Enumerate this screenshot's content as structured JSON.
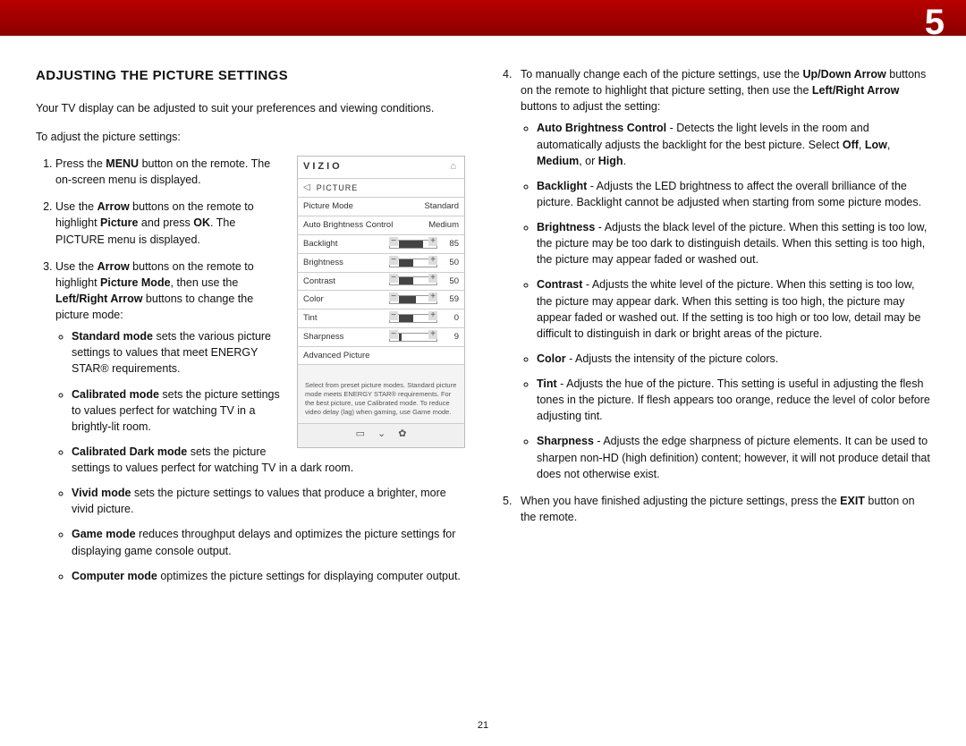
{
  "chapter": "5",
  "pageNumber": "21",
  "heading": "ADJUSTING THE PICTURE SETTINGS",
  "intro": "Your TV display can be adjusted to suit your preferences and viewing conditions.",
  "lead": "To adjust the picture settings:",
  "step1_a": "Press the ",
  "step1_b": "MENU",
  "step1_c": " button on the remote. The on-screen menu is displayed.",
  "step2_a": "Use the ",
  "step2_b": "Arrow",
  "step2_c": " buttons on the remote to highlight ",
  "step2_d": "Picture",
  "step2_e": " and press ",
  "step2_f": "OK",
  "step2_g": ". The PICTURE menu is displayed.",
  "step3_a": "Use the ",
  "step3_b": "Arrow",
  "step3_c": " buttons on the remote to highlight ",
  "step3_d": "Picture Mode",
  "step3_e": ", then use the ",
  "step3_f": "Left/Right Arrow",
  "step3_g": " buttons to change the picture mode:",
  "mode_std_a": "Standard mode",
  "mode_std_b": " sets the various picture settings to values that meet ENERGY STAR® requirements.",
  "mode_cal_a": "Calibrated mode",
  "mode_cal_b": " sets the picture settings to values perfect for watching TV in a brightly-lit room.",
  "mode_caldark_a": "Calibrated Dark mode",
  "mode_caldark_b": " sets the picture settings to values perfect for watching TV in a dark room.",
  "mode_vivid_a": "Vivid mode",
  "mode_vivid_b": " sets the picture settings to values that produce a brighter, more vivid picture.",
  "mode_game_a": "Game mode",
  "mode_game_b": " reduces throughput delays and optimizes the picture settings for displaying game console output.",
  "mode_comp_a": "Computer mode",
  "mode_comp_b": " optimizes the picture settings for displaying computer output.",
  "step4_a": "To manually change each of the picture settings, use the ",
  "step4_b": "Up/Down Arrow",
  "step4_c": " buttons on the remote to highlight that picture setting, then use the ",
  "step4_d": "Left/Right Arrow",
  "step4_e": " buttons to adjust the setting:",
  "set_abc_a": "Auto Brightness Control",
  "set_abc_b": " - Detects the light levels in the room and automatically adjusts the backlight for the best picture. Select ",
  "set_abc_c": "Off",
  "set_abc_d": ", ",
  "set_abc_e": "Low",
  "set_abc_f": ", ",
  "set_abc_g": "Medium",
  "set_abc_h": ", or ",
  "set_abc_i": "High",
  "set_abc_j": ".",
  "set_back_a": "Backlight",
  "set_back_b": " - Adjusts the LED brightness to affect the overall brilliance of the picture. Backlight cannot be adjusted when starting from some picture modes.",
  "set_bri_a": "Brightness",
  "set_bri_b": " - Adjusts the black level of the picture. When this setting is too low, the picture may be too dark to distinguish details. When this setting is too high, the picture may appear faded or washed out.",
  "set_con_a": "Contrast",
  "set_con_b": " - Adjusts the white level of the picture. When this setting is too low, the picture may appear dark. When this setting is too high, the picture may appear faded or washed out. If the setting is too high or too low, detail may be difficult to distinguish in dark or bright areas of the picture.",
  "set_col_a": "Color",
  "set_col_b": " - Adjusts the intensity of the picture colors.",
  "set_tint_a": "Tint",
  "set_tint_b": " - Adjusts the hue of the picture. This setting is useful in adjusting the flesh tones in the picture. If flesh appears too orange, reduce the level of color before adjusting tint.",
  "set_sharp_a": "Sharpness",
  "set_sharp_b": " - Adjusts the edge sharpness of picture elements. It can be used to sharpen non-HD (high definition) content; however, it will not produce detail that does not otherwise exist.",
  "step5_a": "When you have finished adjusting the picture settings, press the ",
  "step5_b": "EXIT",
  "step5_c": " button on the remote.",
  "osd": {
    "brand": "VIZIO",
    "section": "PICTURE",
    "rows": {
      "pm_label": "Picture Mode",
      "pm_val": "Standard",
      "abc_label": "Auto Brightness Control",
      "abc_val": "Medium",
      "back_label": "Backlight",
      "back_val": "85",
      "bri_label": "Brightness",
      "bri_val": "50",
      "con_label": "Contrast",
      "con_val": "50",
      "col_label": "Color",
      "col_val": "59",
      "tint_label": "Tint",
      "tint_val": "0",
      "sharp_label": "Sharpness",
      "sharp_val": "9",
      "adv_label": "Advanced Picture"
    },
    "note": "Select from preset picture modes. Standard picture mode meets ENERGY STAR® requirements. For the best picture, use Calibrated mode. To reduce video delay (lag) when gaming, use Game mode."
  }
}
